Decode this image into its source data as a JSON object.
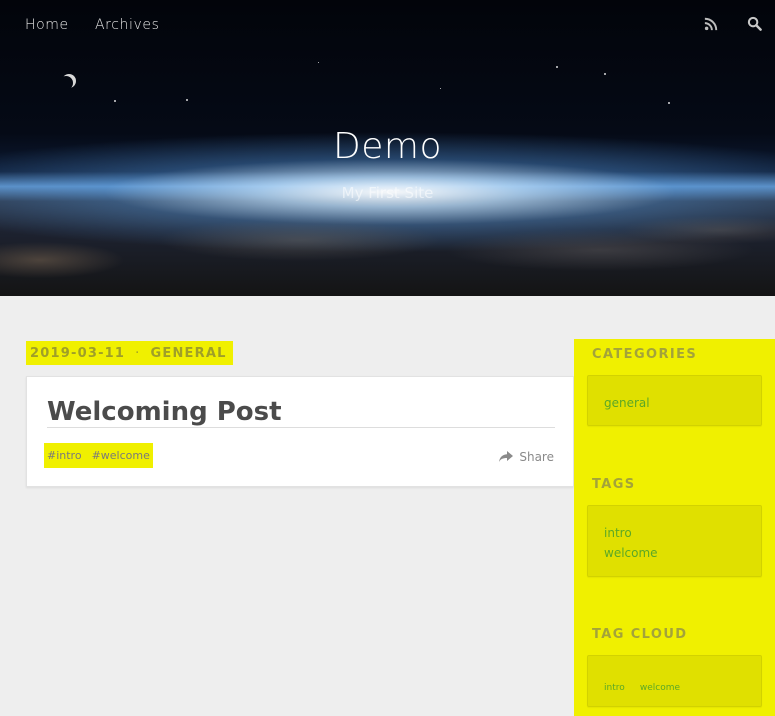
{
  "nav": {
    "items": [
      {
        "label": "Home"
      },
      {
        "label": "Archives"
      }
    ],
    "icons": [
      "rss-icon",
      "search-icon"
    ]
  },
  "site": {
    "title": "Demo",
    "subtitle": "My First Site"
  },
  "post": {
    "date": "2019-03-11",
    "separator": "·",
    "category": "GENERAL",
    "title": "Welcoming Post",
    "tags": [
      "#intro",
      "#welcome"
    ],
    "share_label": "Share"
  },
  "sidebar": {
    "categories": {
      "title": "CATEGORIES",
      "items": [
        "general"
      ]
    },
    "tags": {
      "title": "TAGS",
      "items": [
        "intro",
        "welcome"
      ]
    },
    "tag_cloud": {
      "title": "TAG CLOUD",
      "items": [
        "intro",
        "welcome"
      ]
    }
  },
  "colors": {
    "highlight": "#f0f000",
    "link": "#5ba826",
    "heading": "#a3a33a"
  }
}
